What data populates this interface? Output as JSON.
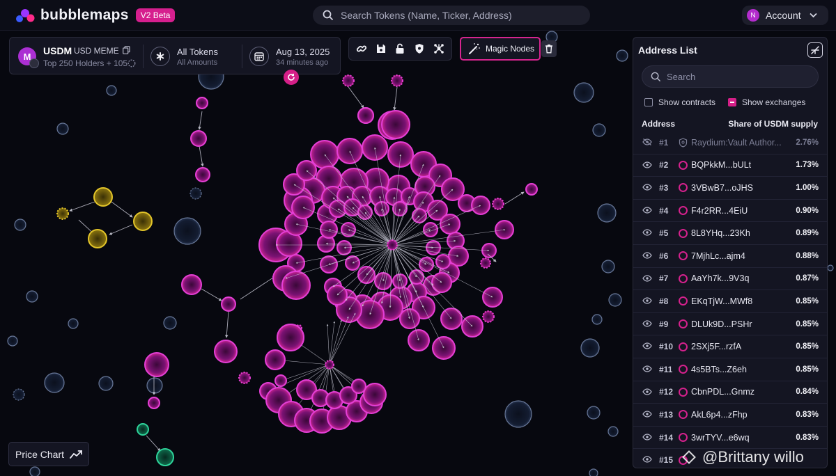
{
  "app": {
    "brand": "bubblemaps",
    "beta_badge": "V2 Beta"
  },
  "header": {
    "search_placeholder": "Search Tokens (Name, Ticker, Address)",
    "account_initial": "N",
    "account_label": "Account"
  },
  "token": {
    "symbol": "USDM",
    "name": "USD MEME",
    "icon_letter": "M",
    "holders_summary": "Top 250 Holders + 105",
    "filter_title": "All Tokens",
    "filter_sub": "All Amounts",
    "date_title": "Aug 13, 2025",
    "date_sub": "34 minutes ago"
  },
  "toolbar": {
    "tools": [
      "link-icon",
      "save-icon",
      "lock-icon",
      "shield-icon",
      "network-icon"
    ],
    "magic_nodes_label": "Magic Nodes"
  },
  "address_list": {
    "title": "Address List",
    "search_placeholder": "Search",
    "show_contracts_label": "Show contracts",
    "show_contracts_checked": false,
    "show_exchanges_label": "Show exchanges",
    "show_exchanges_checked": true,
    "col_address": "Address",
    "col_share": "Share of USDM supply",
    "rows": [
      {
        "rank": "#1",
        "address": "Raydium:Vault Author...",
        "share": "2.76%",
        "hidden": true,
        "contract": true
      },
      {
        "rank": "#2",
        "address": "BQPkkM...bULt",
        "share": "1.73%"
      },
      {
        "rank": "#3",
        "address": "3VBwB7...oJHS",
        "share": "1.00%"
      },
      {
        "rank": "#4",
        "address": "F4r2RR...4EiU",
        "share": "0.90%"
      },
      {
        "rank": "#5",
        "address": "8L8YHq...23Kh",
        "share": "0.89%"
      },
      {
        "rank": "#6",
        "address": "7MjhLc...ajm4",
        "share": "0.88%"
      },
      {
        "rank": "#7",
        "address": "AaYh7k...9V3q",
        "share": "0.87%"
      },
      {
        "rank": "#8",
        "address": "EKqTjW...MWf8",
        "share": "0.85%"
      },
      {
        "rank": "#9",
        "address": "DLUk9D...PSHr",
        "share": "0.85%"
      },
      {
        "rank": "#10",
        "address": "2SXj5F...rzfA",
        "share": "0.85%"
      },
      {
        "rank": "#11",
        "address": "4s5BTs...Z6eh",
        "share": "0.85%"
      },
      {
        "rank": "#12",
        "address": "CbnPDL...Gnmz",
        "share": "0.84%"
      },
      {
        "rank": "#13",
        "address": "AkL6p4...zFhp",
        "share": "0.83%"
      },
      {
        "rank": "#14",
        "address": "3wrTYV...e6wq",
        "share": "0.83%"
      },
      {
        "rank": "#15",
        "address": "",
        "share": ""
      }
    ]
  },
  "price_chart_label": "Price Chart",
  "watermark": "@Brittany willo",
  "colors": {
    "accent": "#d6218d",
    "bubble_magenta": "#e33fd6",
    "bubble_yellow": "#e2c429",
    "bubble_green": "#2ed39a",
    "bubble_grey": "#7f92b8",
    "background": "#07080f"
  }
}
